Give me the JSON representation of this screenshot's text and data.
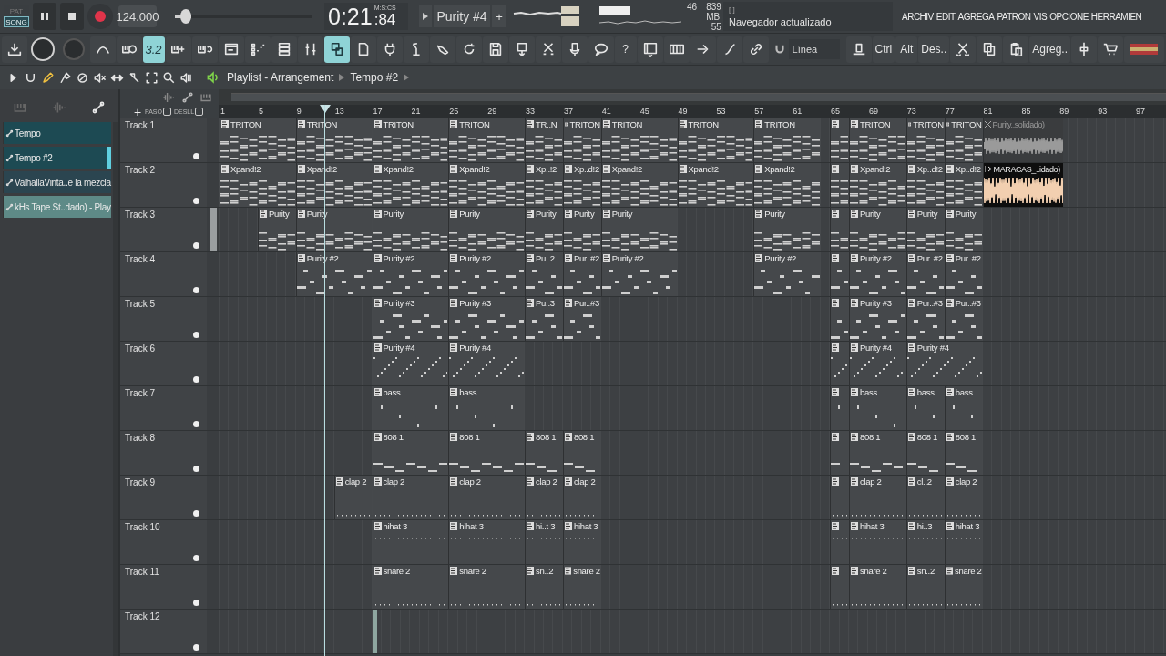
{
  "transport": {
    "modes": [
      {
        "label": "PAT",
        "selected": false
      },
      {
        "label": "SONG",
        "selected": true
      }
    ],
    "tempo": "124.000",
    "pitch_slider": {
      "level": 0.12
    },
    "time": "0:21",
    "time_fraction": ":84",
    "time_format": "M:S:CS",
    "pattern": "Purity #4",
    "pattern_add": "+"
  },
  "monitor": {
    "cpu": "46",
    "memory": "839 MB",
    "polyphony": "55"
  },
  "hint_bar": {
    "title": "[ ]",
    "message": "Navegador actualizado"
  },
  "menu": [
    "ARCHIV",
    "EDIT",
    "AGREGA",
    "PATRON",
    "VIS",
    "OPCIONE",
    "HERRAMIEN"
  ],
  "toolbar": [
    {
      "kind": "icon",
      "selected": false
    },
    {
      "kind": "knob"
    },
    {
      "kind": "knob"
    },
    {
      "kind": "icon",
      "selected": false
    },
    {
      "kind": "icon",
      "selected": false
    },
    {
      "kind": "text",
      "label": "3.2",
      "selected": true
    },
    {
      "kind": "icon",
      "selected": false
    },
    {
      "kind": "icon",
      "selected": false
    },
    {
      "kind": "icon",
      "selected": false
    },
    {
      "kind": "icon",
      "selected": false
    },
    {
      "kind": "icon",
      "selected": false
    },
    {
      "kind": "icon",
      "selected": false
    },
    {
      "kind": "icon",
      "selected": true
    },
    {
      "kind": "icon",
      "selected": false
    },
    {
      "kind": "icon",
      "selected": false
    },
    {
      "kind": "icon",
      "selected": false
    },
    {
      "kind": "icon",
      "selected": false
    },
    {
      "kind": "icon",
      "selected": false
    },
    {
      "kind": "icon",
      "selected": false
    },
    {
      "kind": "icon",
      "selected": false
    },
    {
      "kind": "icon",
      "selected": false
    },
    {
      "kind": "icon",
      "selected": false
    },
    {
      "kind": "icon",
      "selected": false
    },
    {
      "kind": "text",
      "label": "?",
      "selected": false
    },
    {
      "kind": "icon",
      "selected": false
    },
    {
      "kind": "icon",
      "selected": false
    },
    {
      "kind": "icon",
      "selected": false
    },
    {
      "kind": "icon",
      "selected": false
    },
    {
      "kind": "icon",
      "selected": false
    },
    {
      "kind": "dropdown",
      "label": "Línea",
      "selected": false
    },
    {
      "kind": "icon",
      "selected": false
    },
    {
      "kind": "text",
      "label": "Ctrl",
      "selected": false
    },
    {
      "kind": "text",
      "label": "Alt",
      "selected": false
    },
    {
      "kind": "text",
      "label": "Des..",
      "selected": false
    },
    {
      "kind": "icon",
      "selected": false
    },
    {
      "kind": "icon",
      "selected": false
    },
    {
      "kind": "icon",
      "selected": false
    },
    {
      "kind": "text",
      "label": "Agreg..",
      "selected": false
    },
    {
      "kind": "icon",
      "selected": false
    },
    {
      "kind": "icon",
      "selected": false
    },
    {
      "kind": "flag",
      "selected": false
    }
  ],
  "source_filters": [
    {
      "selected": false
    },
    {
      "selected": false
    },
    {
      "selected": true
    }
  ],
  "clip_sources": [
    {
      "label": "Tempo",
      "color": "#1d4a53",
      "selected": false
    },
    {
      "label": "Tempo #2",
      "color": "#1d4a53",
      "selected": true
    },
    {
      "label": "ValhallaVinta..e la mezcla",
      "color": "#2b4550",
      "selected": false
    },
    {
      "label": "kHs Tape St..dado) - Play",
      "color": "#5e8a87",
      "selected": false
    }
  ],
  "playlist": {
    "tools": [
      {
        "selected": false
      },
      {
        "selected": false
      },
      {
        "selected": true
      },
      {
        "selected": false
      },
      {
        "selected": false
      },
      {
        "selected": false
      },
      {
        "selected": false
      },
      {
        "selected": false
      },
      {
        "selected": false
      },
      {
        "selected": false
      },
      {
        "selected": false
      }
    ],
    "title": "Playlist - Arrangement",
    "breadcrumb": "Tempo #2",
    "add": "+",
    "snap_labels": [
      "PASO",
      "DESLL"
    ],
    "ruler": [
      "1",
      "5",
      "9",
      "13",
      "17",
      "21",
      "25",
      "29",
      "33",
      "37",
      "41",
      "45",
      "49",
      "53",
      "57",
      "61",
      "65",
      "69",
      "73",
      "77",
      "81",
      "85",
      "89",
      "93",
      "97"
    ],
    "tracks": [
      {
        "name": "Track 1",
        "clips": [
          {
            "kind": "pattern",
            "label": "TRITON"
          },
          {
            "kind": "pattern",
            "label": "TRITON"
          },
          {
            "kind": "pattern",
            "label": "TRITON"
          },
          {
            "kind": "pattern",
            "label": "TRITON"
          },
          {
            "kind": "pattern",
            "label": "TR..N"
          },
          {
            "kind": "pattern",
            "label": "TRITON"
          },
          {
            "kind": "pattern",
            "label": "TRITON"
          },
          {
            "kind": "pattern",
            "label": "TRITON"
          },
          {
            "kind": "pattern",
            "label": "TRITON"
          },
          {
            "kind": "pattern"
          },
          {
            "kind": "pattern",
            "label": "TRITON"
          },
          {
            "kind": "pattern",
            "label": "TRITON"
          },
          {
            "kind": "pattern",
            "label": "TRITON"
          },
          {
            "kind": "audio",
            "label": "Purity..solidado)",
            "muted": true,
            "color": "#9a9a9a"
          }
        ]
      },
      {
        "name": "Track 2",
        "clips": [
          {
            "kind": "pattern",
            "label": "Xpand!2"
          },
          {
            "kind": "pattern",
            "label": "Xpand!2"
          },
          {
            "kind": "pattern",
            "label": "Xpand!2"
          },
          {
            "kind": "pattern",
            "label": "Xpand!2"
          },
          {
            "kind": "pattern",
            "label": "Xp..!2"
          },
          {
            "kind": "pattern",
            "label": "Xp..d!2"
          },
          {
            "kind": "pattern",
            "label": "Xpand!2"
          },
          {
            "kind": "pattern",
            "label": "Xpand!2"
          },
          {
            "kind": "pattern",
            "label": "Xpand!2"
          },
          {
            "kind": "pattern"
          },
          {
            "kind": "pattern",
            "label": "Xpand!2"
          },
          {
            "kind": "pattern",
            "label": "Xp..d!2"
          },
          {
            "kind": "pattern",
            "label": "Xp..d!2"
          },
          {
            "kind": "audio",
            "label": "MARACAS_..idado)",
            "muted": false,
            "color": "#f2cfb0"
          }
        ]
      },
      {
        "name": "Track 3",
        "clips": [
          {
            "kind": "pattern",
            "label": "Purity"
          },
          {
            "kind": "pattern",
            "label": "Purity"
          },
          {
            "kind": "pattern",
            "label": "Purity"
          },
          {
            "kind": "pattern",
            "label": "Purity"
          },
          {
            "kind": "pattern",
            "label": "Purity"
          },
          {
            "kind": "pattern",
            "label": "Purity"
          },
          {
            "kind": "pattern",
            "label": "Purity"
          },
          {
            "kind": "pattern",
            "label": "Purity"
          },
          {
            "kind": "pattern"
          },
          {
            "kind": "pattern",
            "label": "Purity"
          },
          {
            "kind": "pattern",
            "label": "Purity"
          },
          {
            "kind": "pattern",
            "label": "Purity"
          }
        ]
      },
      {
        "name": "Track 4",
        "clips": [
          {
            "kind": "pattern",
            "label": "Purity #2"
          },
          {
            "kind": "pattern",
            "label": "Purity #2"
          },
          {
            "kind": "pattern",
            "label": "Purity #2"
          },
          {
            "kind": "pattern",
            "label": "Pu..2"
          },
          {
            "kind": "pattern",
            "label": "Pur..#2"
          },
          {
            "kind": "pattern",
            "label": "Purity #2"
          },
          {
            "kind": "pattern",
            "label": "Purity #2"
          },
          {
            "kind": "pattern"
          },
          {
            "kind": "pattern",
            "label": "Purity #2"
          },
          {
            "kind": "pattern",
            "label": "Pur..#2"
          },
          {
            "kind": "pattern",
            "label": "Pur..#2"
          }
        ]
      },
      {
        "name": "Track 5",
        "clips": [
          {
            "kind": "pattern",
            "label": "Purity #3"
          },
          {
            "kind": "pattern",
            "label": "Purity #3"
          },
          {
            "kind": "pattern",
            "label": "Pu..3"
          },
          {
            "kind": "pattern",
            "label": "Pur..#3"
          },
          {
            "kind": "pattern"
          },
          {
            "kind": "pattern",
            "label": "Purity #3"
          },
          {
            "kind": "pattern",
            "label": "Pur..#3"
          },
          {
            "kind": "pattern",
            "label": "Pur..#3"
          }
        ]
      },
      {
        "name": "Track 6",
        "clips": [
          {
            "kind": "pattern",
            "label": "Purity #4"
          },
          {
            "kind": "pattern",
            "label": "Purity #4"
          },
          {
            "kind": "pattern"
          },
          {
            "kind": "pattern",
            "label": "Purity #4"
          },
          {
            "kind": "pattern",
            "label": "Purity #4"
          }
        ]
      },
      {
        "name": "Track 7",
        "clips": [
          {
            "kind": "pattern",
            "label": "bass"
          },
          {
            "kind": "pattern",
            "label": "bass"
          },
          {
            "kind": "pattern"
          },
          {
            "kind": "pattern",
            "label": "bass"
          },
          {
            "kind": "pattern",
            "label": "bass"
          },
          {
            "kind": "pattern",
            "label": "bass"
          }
        ]
      },
      {
        "name": "Track 8",
        "clips": [
          {
            "kind": "pattern",
            "label": "808 1"
          },
          {
            "kind": "pattern",
            "label": "808 1"
          },
          {
            "kind": "pattern",
            "label": "808 1"
          },
          {
            "kind": "pattern",
            "label": "808 1"
          },
          {
            "kind": "pattern"
          },
          {
            "kind": "pattern",
            "label": "808 1"
          },
          {
            "kind": "pattern",
            "label": "808 1"
          },
          {
            "kind": "pattern",
            "label": "808 1"
          }
        ]
      },
      {
        "name": "Track 9",
        "clips": [
          {
            "kind": "pattern",
            "label": "clap 2"
          },
          {
            "kind": "pattern",
            "label": "clap 2"
          },
          {
            "kind": "pattern",
            "label": "clap 2"
          },
          {
            "kind": "pattern",
            "label": "clap 2"
          },
          {
            "kind": "pattern",
            "label": "clap 2"
          },
          {
            "kind": "pattern"
          },
          {
            "kind": "pattern",
            "label": "clap 2"
          },
          {
            "kind": "pattern",
            "label": "cl..2"
          },
          {
            "kind": "pattern",
            "label": "clap 2"
          }
        ]
      },
      {
        "name": "Track 10",
        "clips": [
          {
            "kind": "pattern",
            "label": "hihat 3"
          },
          {
            "kind": "pattern",
            "label": "hihat 3"
          },
          {
            "kind": "pattern",
            "label": "hi..t 3"
          },
          {
            "kind": "pattern",
            "label": "hihat 3"
          },
          {
            "kind": "pattern"
          },
          {
            "kind": "pattern",
            "label": "hihat 3"
          },
          {
            "kind": "pattern",
            "label": "hi..3"
          },
          {
            "kind": "pattern",
            "label": "hihat 3"
          }
        ]
      },
      {
        "name": "Track 11",
        "clips": [
          {
            "kind": "pattern",
            "label": "snare 2"
          },
          {
            "kind": "pattern",
            "label": "snare 2"
          },
          {
            "kind": "pattern",
            "label": "sn..2"
          },
          {
            "kind": "pattern",
            "label": "snare 2"
          },
          {
            "kind": "pattern"
          },
          {
            "kind": "pattern",
            "label": "snare 2"
          },
          {
            "kind": "pattern",
            "label": "sn..2"
          },
          {
            "kind": "pattern",
            "label": "snare 2"
          }
        ]
      },
      {
        "name": "Track 12",
        "clips": [
          {
            "kind": "automation"
          }
        ]
      }
    ]
  }
}
